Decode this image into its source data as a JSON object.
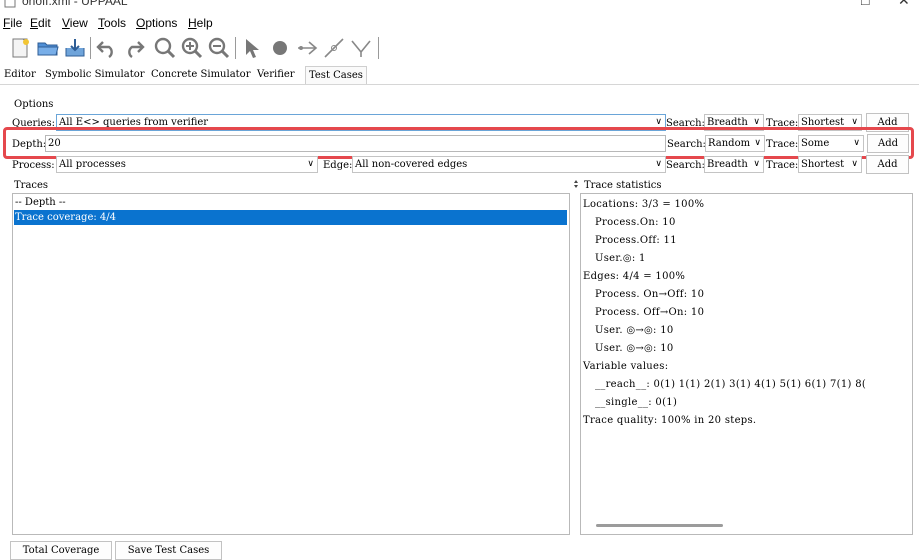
{
  "window": {
    "title": "onoff.xml - UPPAAL",
    "restore_glyph": "□",
    "close_glyph": "✕"
  },
  "menu": [
    {
      "label": "File",
      "mnemonic": "F",
      "rest": "ile"
    },
    {
      "label": "Edit",
      "mnemonic": "E",
      "rest": "dit"
    },
    {
      "label": "View",
      "mnemonic": "V",
      "rest": "iew"
    },
    {
      "label": "Tools",
      "mnemonic": "T",
      "rest": "ools"
    },
    {
      "label": "Options",
      "mnemonic": "O",
      "rest": "ptions"
    },
    {
      "label": "Help",
      "mnemonic": "H",
      "rest": "elp"
    }
  ],
  "toolbar": {
    "icons": [
      "new-file-icon",
      "open-folder-icon",
      "save-icon",
      "undo-icon",
      "redo-icon",
      "zoom-fit-icon",
      "zoom-in-icon",
      "zoom-out-icon",
      "select-arrow-icon",
      "location-icon",
      "edge-icon",
      "nail-icon",
      "branch-icon"
    ]
  },
  "tabs": [
    "Editor",
    "Symbolic Simulator",
    "Concrete Simulator",
    "Verifier",
    "Test Cases"
  ],
  "options": {
    "section_label": "Options",
    "queries_label": "Queries:",
    "queries_value": "All E<> queries from verifier",
    "search_label": "Search:",
    "trace_label": "Trace:",
    "add_label": "Add",
    "row1": {
      "search": "Breadth",
      "trace": "Shortest"
    },
    "depth_label": "Depth:",
    "depth_value": "20",
    "row2": {
      "search": "Random",
      "trace": "Some"
    },
    "process_label": "Process:",
    "process_value": "All processes",
    "edge_label": "Edge:",
    "edge_value": "All non-covered edges",
    "row3": {
      "search": "Breadth",
      "trace": "Shortest"
    }
  },
  "traces": {
    "title": "Traces",
    "rows": [
      "-- Depth --",
      "Trace coverage: 4/4"
    ]
  },
  "stats": {
    "title": "Trace statistics",
    "lines": [
      "Locations: 3/3 = 100%",
      "Process.On: 10",
      "Process.Off: 11",
      "User.◎: 1",
      "Edges: 4/4 = 100%",
      "Process. On→Off: 10",
      "Process. Off→On: 10",
      "User. ◎→◎: 10",
      "User. ◎→◎: 10",
      "Variable values:",
      "__reach__: 0(1) 1(1) 2(1) 3(1) 4(1) 5(1) 6(1) 7(1) 8(",
      "__single__: 0(1)",
      "Trace quality: 100% in 20 steps."
    ]
  },
  "bottom": {
    "total_coverage": "Total Coverage",
    "save_test_cases": "Save Test Cases"
  },
  "colors": {
    "highlight": "#e5484d",
    "selection": "#0a73cf"
  }
}
